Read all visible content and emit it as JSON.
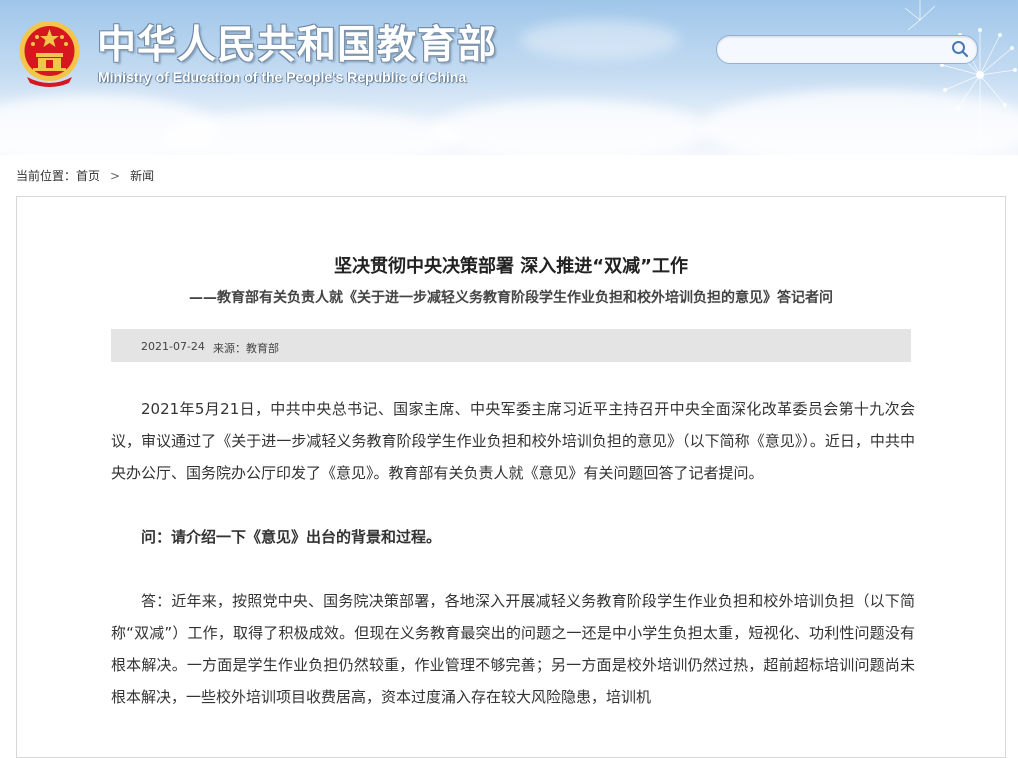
{
  "header": {
    "title": "中华人民共和国教育部",
    "subtitle": "Ministry of Education of the People's Republic of China"
  },
  "search": {
    "placeholder": "",
    "icon": "search-icon"
  },
  "breadcrumb": {
    "prefix": "当前位置：",
    "home": "首页",
    "separator": ">",
    "current": "新闻"
  },
  "article": {
    "title": "坚决贯彻中央决策部署 深入推进“双减”工作",
    "subtitle": "——教育部有关负责人就《关于进一步减轻义务教育阶段学生作业负担和校外培训负担的意见》答记者问",
    "date": "2021-07-24",
    "source": "来源：教育部",
    "paragraphs": [
      "2021年5月21日，中共中央总书记、国家主席、中央军委主席习近平主持召开中央全面深化改革委员会第十九次会议，审议通过了《关于进一步减轻义务教育阶段学生作业负担和校外培训负担的意见》（以下简称《意见》）。近日，中共中央办公厅、国务院办公厅印发了《意见》。教育部有关负责人就《意见》有关问题回答了记者提问。",
      "问：请介绍一下《意见》出台的背景和过程。",
      "答：近年来，按照党中央、国务院决策部署，各地深入开展减轻义务教育阶段学生作业负担和校外培训负担（以下简称“双减”）工作，取得了积极成效。但现在义务教育最突出的问题之一还是中小学生负担太重，短视化、功利性问题没有根本解决。一方面是学生作业负担仍然较重，作业管理不够完善；另一方面是校外培训仍然过热，超前超标培训问题尚未根本解决，一些校外培训项目收费居高，资本过度涌入存在较大风险隐患，培训机"
    ]
  },
  "colors": {
    "banner_top": "#9fc6ea",
    "emblem_red": "#d7171f",
    "emblem_gold": "#f3c54a",
    "meta_bar": "#e4e4e4",
    "panel_border": "#d7d7d7"
  }
}
